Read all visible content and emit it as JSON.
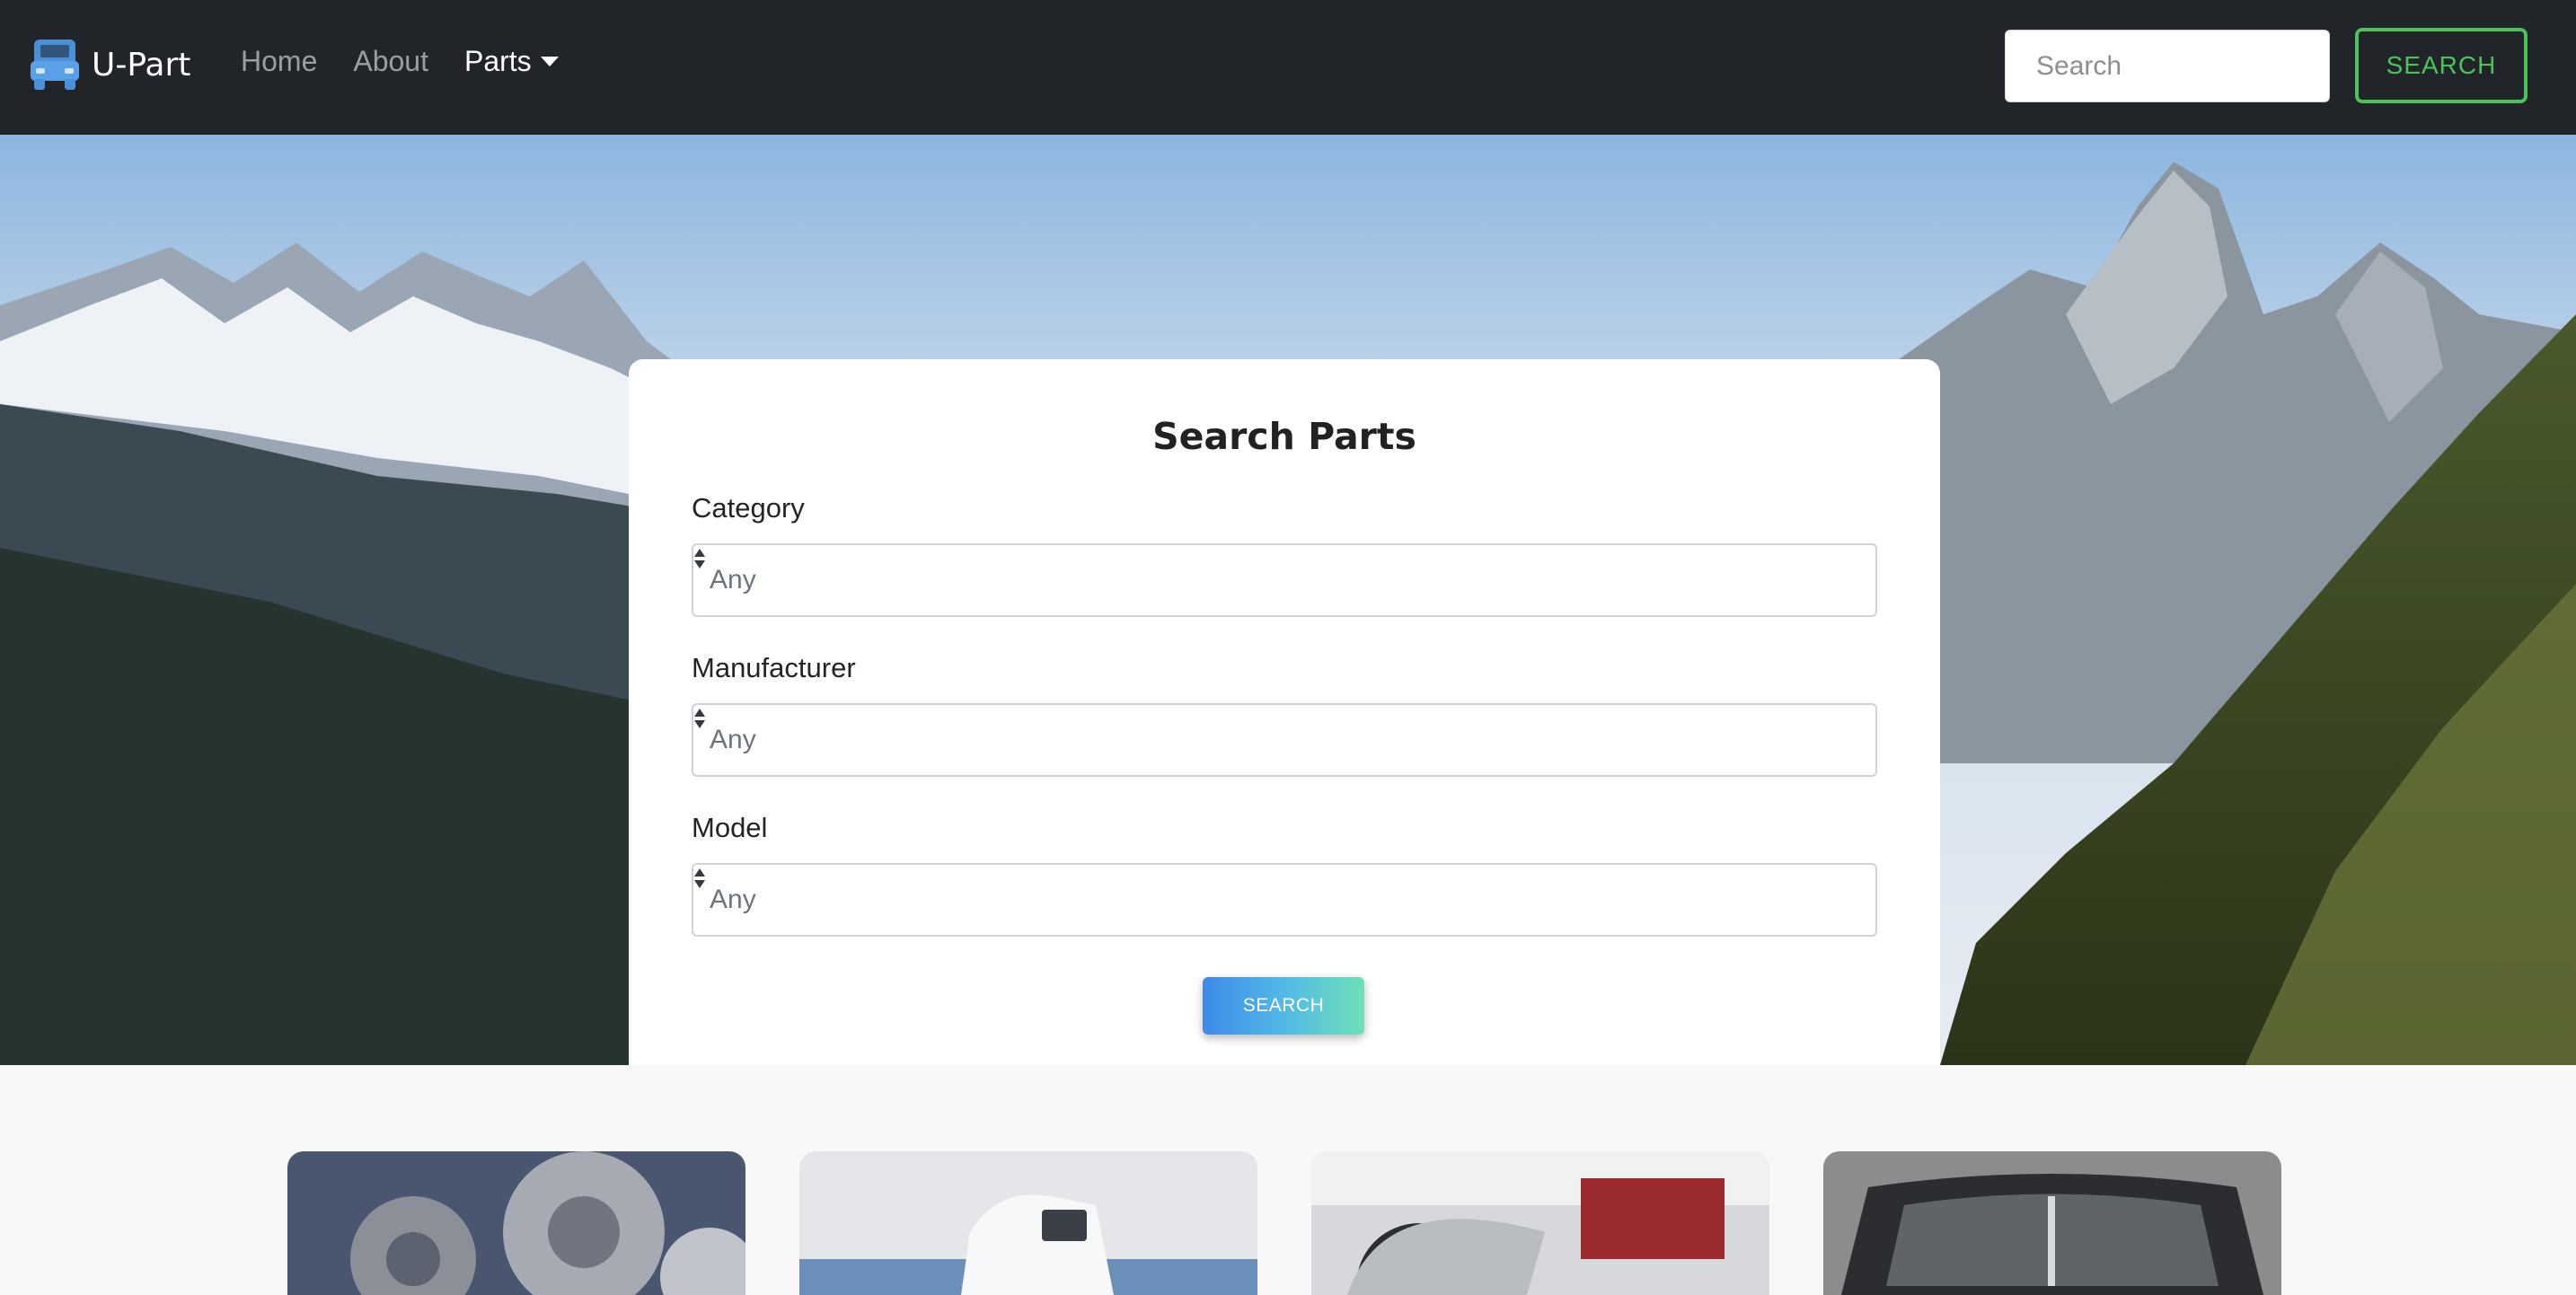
{
  "navbar": {
    "brand": "U-Part",
    "links": [
      {
        "label": "Home"
      },
      {
        "label": "About"
      },
      {
        "label": "Parts"
      }
    ],
    "search_placeholder": "Search",
    "search_button": "SEARCH"
  },
  "search_card": {
    "title": "Search Parts",
    "fields": [
      {
        "label": "Category",
        "value": "Any"
      },
      {
        "label": "Manufacturer",
        "value": "Any"
      },
      {
        "label": "Model",
        "value": "Any"
      }
    ],
    "button": "SEARCH"
  },
  "colors": {
    "navbar_bg": "#212529",
    "accent_green": "#4cc35a",
    "brand_icon": "#4a90d9",
    "button_gradient_start": "#3d8ae8",
    "button_gradient_end": "#6fe0b8"
  },
  "icons": {
    "brand": "truck-icon",
    "dropdown": "caret-down-icon",
    "select": "select-arrows-icon"
  }
}
